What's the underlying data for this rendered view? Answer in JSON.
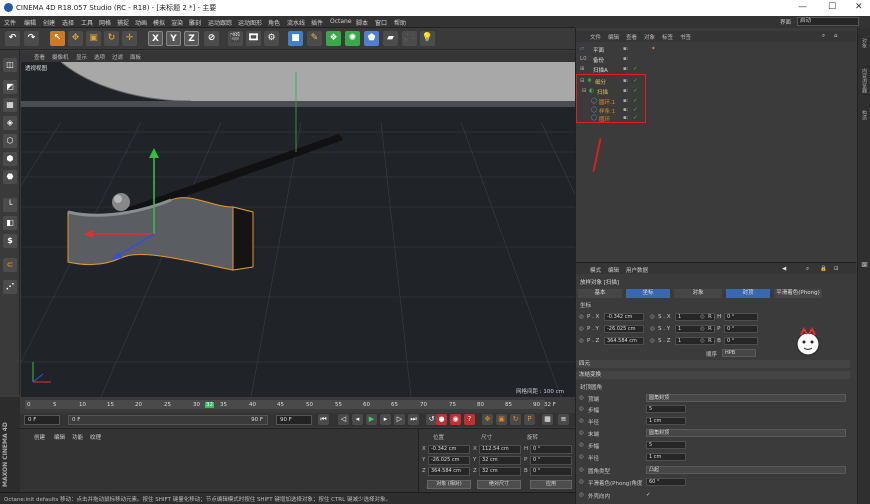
{
  "window": {
    "title": "CINEMA 4D R18.057 Studio (RC - R18) - [未标题 2 *] - 主要"
  },
  "menu": [
    "文件",
    "编辑",
    "创建",
    "选择",
    "工具",
    "网格",
    "捕捉",
    "动画",
    "模拟",
    "渲染",
    "雕刻",
    "运动跟踪",
    "运动图形",
    "角色",
    "流水线",
    "插件",
    "Octane",
    "脚本",
    "窗口",
    "帮助"
  ],
  "layout": {
    "label": "界面",
    "value": "启动"
  },
  "viewport": {
    "menu": [
      "查看",
      "摄像机",
      "显示",
      "选项",
      "过滤",
      "面板"
    ],
    "label": "透视视图",
    "grid_spacing": "网格间距 : 100 cm"
  },
  "toolbar": {
    "axis_x": "X",
    "axis_y": "Y",
    "axis_z": "Z"
  },
  "timeline": {
    "ticks": [
      "0",
      "5",
      "10",
      "15",
      "20",
      "25",
      "30",
      "32",
      "35",
      "40",
      "45",
      "50",
      "55",
      "60",
      "65",
      "70",
      "75",
      "80",
      "85",
      "90"
    ],
    "current_frame_badge": "32 F",
    "start_field": "0 F",
    "range_start": "0 F",
    "range_end": "90 F",
    "end_field": "90 F"
  },
  "material_panel": {
    "menu": [
      "创建",
      "编辑",
      "功能",
      "纹理"
    ]
  },
  "coords": {
    "headers": {
      "position": "位置",
      "size": "尺寸",
      "rotation": "旋转"
    },
    "rows": [
      {
        "axis": "X",
        "pos": "-0.342 cm",
        "size": "112.54 cm",
        "rot_axis": "H",
        "rot": "0 °"
      },
      {
        "axis": "Y",
        "pos": "-26.025 cm",
        "size": "32 cm",
        "rot_axis": "P",
        "rot": "0 °"
      },
      {
        "axis": "Z",
        "pos": "364.584 cm",
        "size": "32 cm",
        "rot_axis": "B",
        "rot": "0 °"
      }
    ],
    "mode_object": "对象 (相对)",
    "mode_size": "绝对尺寸",
    "apply": "应用"
  },
  "status": "Octane:init defaults    移动：点击并拖动鼠标移动元素。按住 SHIFT 键量化移动；节点编辑模式时按住 SHIFT 键增加选择对象；按住 CTRL 键减少选择对象。",
  "maxon_logo": "MAXON CINEMA 4D",
  "object_manager": {
    "menu": [
      "文件",
      "编辑",
      "查看",
      "对象",
      "标签",
      "书签"
    ],
    "objects": [
      {
        "name": "平面",
        "indent": 0
      },
      {
        "name": "备份",
        "indent": 0
      },
      {
        "name": "扫描A",
        "indent": 0
      },
      {
        "name": "细分",
        "indent": 0
      },
      {
        "name": "扫描",
        "indent": 0
      },
      {
        "name": "圆环.1",
        "indent": 1
      },
      {
        "name": "样条.1",
        "indent": 1
      },
      {
        "name": "圆环",
        "indent": 1
      }
    ]
  },
  "attr": {
    "menu": [
      "模式",
      "编辑",
      "用户数据"
    ],
    "object_title": "放样对象 [扫描]",
    "tabs": [
      "基本",
      "坐标",
      "对象",
      "封顶",
      "平滑着色(Phong)"
    ],
    "section_coords": "坐标",
    "coord_rows": [
      {
        "p_label": "P . X",
        "p_val": "-0.342 cm",
        "s_label": "S . X",
        "s_val": "1",
        "r_label": "R . H",
        "r_val": "0 °"
      },
      {
        "p_label": "P . Y",
        "p_val": "-26.025 cm",
        "s_label": "S . Y",
        "s_val": "1",
        "r_label": "R . P",
        "r_val": "0 °"
      },
      {
        "p_label": "P . Z",
        "p_val": "364.584 cm",
        "s_label": "S . Z",
        "s_val": "1",
        "r_label": "R . B",
        "r_val": "0 °"
      }
    ],
    "order_label": "顺序",
    "order_value": "HPB",
    "sect_quaternion": "四元",
    "sect_frozen": "冻结变换",
    "sect_caps": "封顶圆角",
    "caps": [
      {
        "label": "顶端",
        "value": "圆角封顶"
      },
      {
        "label": "步幅",
        "value": "5"
      },
      {
        "label": "半径",
        "value": "1 cm"
      },
      {
        "label": "末端",
        "value": "圆角封顶"
      },
      {
        "label": "步幅",
        "value": "5"
      },
      {
        "label": "半径",
        "value": "1 cm"
      },
      {
        "label": "圆角类型",
        "value": "凸起"
      },
      {
        "label": "平滑着色(Phong)角度",
        "value": "60 °"
      },
      {
        "label": "外壳向内",
        "value": "✓"
      }
    ]
  },
  "right_strip": [
    "对象",
    "内容浏览器",
    "构造",
    "层"
  ]
}
